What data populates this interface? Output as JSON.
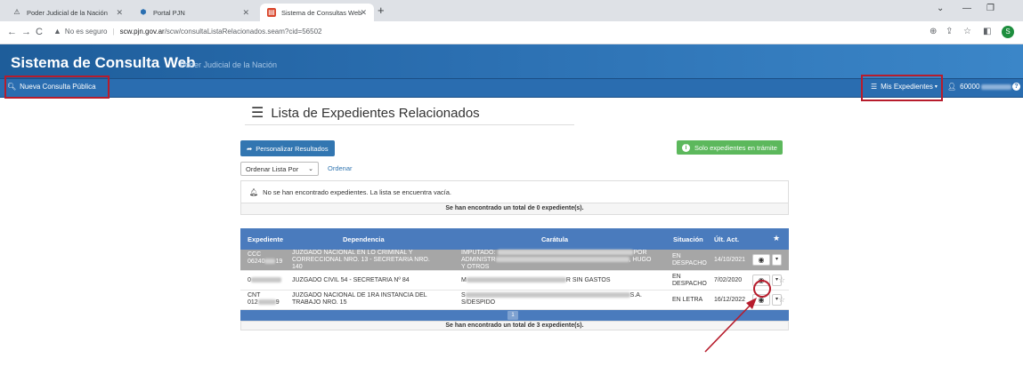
{
  "browser": {
    "tabs": [
      {
        "label": "Poder Judicial de la Nación"
      },
      {
        "label": "Portal PJN"
      },
      {
        "label": "Sistema de Consultas Web"
      }
    ],
    "address": {
      "security_label": "No es seguro",
      "host": "scw.pjn.gov.ar",
      "path": "/scw/consultaListaRelacionados.seam?cid=56502"
    },
    "profile_initial": "S"
  },
  "site": {
    "title": "Sistema de Consulta Web",
    "subtitle": "Poder Judicial de la Nación"
  },
  "nav": {
    "nueva_consulta": "Nueva Consulta Pública",
    "mis_expedientes": "Mis Expedientes",
    "user_prefix": "60000"
  },
  "page": {
    "title": "Lista de Expedientes Relacionados",
    "personalizar_label": "Personalizar Resultados",
    "solo_tramite_label": "Solo expedientes en trámite",
    "order_select_value": "Ordenar Lista Por",
    "ordenar_link": "Ordenar",
    "empty_alert": "No se han encontrado expedientes. La lista se encuentra vacía.",
    "empty_total": "Se han encontrado un total de 0 expediente(s).",
    "full_total": "Se han encontrado un total de 3 expediente(s).",
    "page_number": "1"
  },
  "table": {
    "headers": [
      "Expediente",
      "Dependencia",
      "Carátula",
      "Situación",
      "Últ. Act."
    ],
    "rows": [
      {
        "exp_a": "CCC",
        "exp_b": "06240",
        "exp_c": "19",
        "dep": [
          "JUZGADO NACIONAL EN LO CRIMINAL Y",
          "CORRECCIONAL NRO. 13 - SECRETARIA NRO.",
          "140"
        ],
        "car_a": "IMPUTADO:",
        "car_b_left": "ADMINISTR",
        "car_b_right": ", HUGO",
        "car_c": "Y OTROS",
        "car_d_right": "POR",
        "sit": [
          "EN",
          "DESPACHO"
        ],
        "date": "14/10/2021"
      },
      {
        "exp_a": "0",
        "dep": [
          "JUZGADO CIVIL 54 - SECRETARIA Nº 84"
        ],
        "car_a": "M",
        "car_b_right": "R SIN GASTOS",
        "sit": [
          "EN",
          "DESPACHO"
        ],
        "date": "7/02/2020"
      },
      {
        "exp_a": "CNT",
        "exp_b": "012",
        "exp_c": "9",
        "dep": [
          "JUZGADO NACIONAL DE 1RA INSTANCIA DEL",
          "TRABAJO NRO. 15"
        ],
        "car_a": "S",
        "car_b_right": "S.A.",
        "car_c": "S/DESPIDO",
        "sit": [
          "EN LETRA"
        ],
        "date": "16/12/2022"
      }
    ]
  },
  "colors": {
    "header_blue": "#2b6fb1",
    "table_head_blue": "#4a7bbd",
    "success_green": "#5cb85c",
    "annotation_red": "#b71c2c"
  }
}
